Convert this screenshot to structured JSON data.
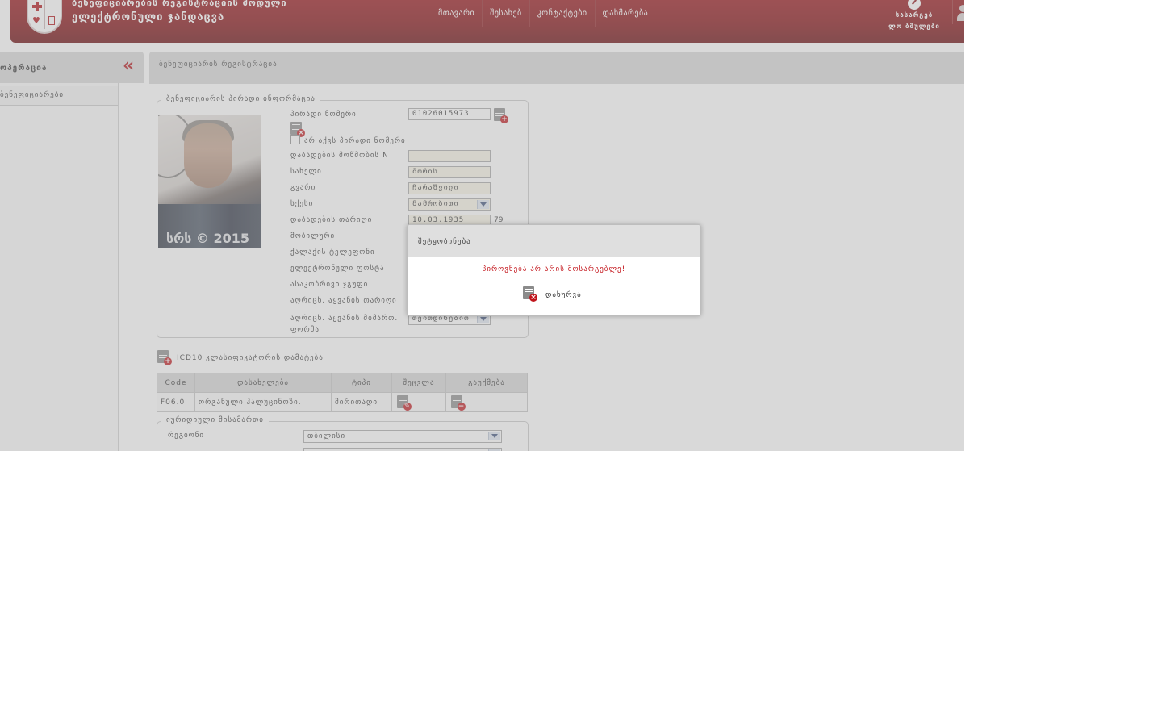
{
  "header": {
    "title_line1": "ბენეფიციარების რეგისტრაციის მოდული",
    "title_line2": "ელექტრონული ჯანდაცვა",
    "nav": [
      "მთავარი",
      "შესახებ",
      "კონტაქტები",
      "დახმარება"
    ],
    "useful_line1": "სასარგებ",
    "useful_line2": "ლო ბმულები",
    "colors": {
      "brand": "#8a0a0f",
      "accent": "#c4161c"
    }
  },
  "sidebar": {
    "title": "ოპერაცია",
    "items": [
      "ბენეფიციარები"
    ]
  },
  "content": {
    "page_title": "ბენეფიციარის რეგისტრაცია",
    "personal": {
      "legend": "ბენეფიციარის პირადი ინფორმაცია",
      "photo_watermark": "სრს © 2015",
      "no_id_label": "არ აქვს პირადი ნომერი",
      "fields": [
        {
          "label": "პირადი ნომერი",
          "value": "01026015973"
        },
        {
          "label": "დაბადების მოწმობის N",
          "value": ""
        },
        {
          "label": "სახელი",
          "value": "მორის"
        },
        {
          "label": "გვარი",
          "value": "ჩარაშვილი"
        },
        {
          "label": "სქესი",
          "value": "მამრობითი"
        },
        {
          "label": "დაბადების თარიღი",
          "value": "10.03.1935"
        },
        {
          "label": "მობილური",
          "value": ""
        },
        {
          "label": "ქალაქის ტელეფონი",
          "value": ""
        },
        {
          "label": "ელექტრონული ფოსტა",
          "value": ""
        },
        {
          "label": "ასაკობრივი ჯგუფი",
          "value": ""
        },
        {
          "label": "აღრიცხ. აყვანის თარიღი",
          "value": ""
        },
        {
          "label": "აღრიცხ. აყვანის მიმართ. ფორმა",
          "value": "თვითდინებით"
        }
      ],
      "age": "79"
    },
    "icd": {
      "add_label": "ICD10 კლასიფიკატორის დამატება",
      "columns": [
        "Code",
        "დასახელება",
        "ტიპი",
        "შეცვლა",
        "გაუქმება"
      ],
      "rows": [
        {
          "code": "F06.0",
          "name": "ორგანული ჰალუცინოზი.",
          "type": "მირითადი"
        }
      ]
    },
    "address": {
      "legend": "იურიდიული მისამართი",
      "region_label": "რეგიონი",
      "region_value": "თბილისი"
    }
  },
  "modal": {
    "title": "შეტყობინება",
    "message": "პიროვნება არ არის მოსარგებლე!",
    "close_label": "დახურვა"
  }
}
